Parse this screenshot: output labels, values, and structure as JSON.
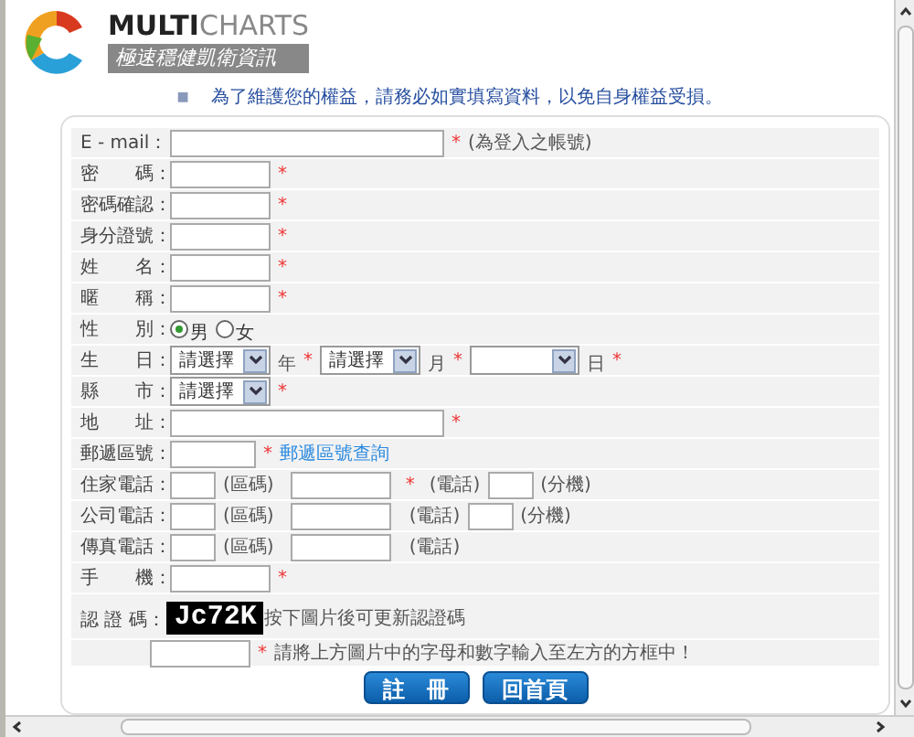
{
  "logo": {
    "brand_bold": "MULTI",
    "brand_light": "CHARTS",
    "tagline": "極速穩健凱衛資訊"
  },
  "notice": {
    "bullet": "■",
    "text": "為了維護您的權益，請務必如實填寫資料，以免自身權益受損。"
  },
  "form": {
    "rows": [
      {
        "kind": "email",
        "label": "E - mail：",
        "mark": "*",
        "note": "(為登入之帳號)"
      },
      {
        "kind": "text",
        "label": "密　　碼：",
        "mark": "*"
      },
      {
        "kind": "text",
        "label": "密碼確認：",
        "mark": "*"
      },
      {
        "kind": "text",
        "label": "身分證號：",
        "mark": "*"
      },
      {
        "kind": "text",
        "label": "姓　　名：",
        "mark": "*"
      },
      {
        "kind": "text",
        "label": "暱　　稱：",
        "mark": "*"
      },
      {
        "kind": "radio",
        "label": "性　　別：",
        "options": [
          {
            "label": "男",
            "selected": true
          },
          {
            "label": "女",
            "selected": false
          }
        ]
      },
      {
        "kind": "date",
        "label": "生　　日：",
        "selects": [
          {
            "value": "請選擇",
            "unit": "年",
            "mark": "*"
          },
          {
            "value": "請選擇",
            "unit": "月",
            "mark": "*"
          },
          {
            "unit": "日",
            "mark": "*"
          }
        ]
      },
      {
        "kind": "select",
        "label": "縣　　市：",
        "value": "請選擇",
        "mark": "*"
      },
      {
        "kind": "address",
        "label": "地　　址：",
        "mark": "*"
      },
      {
        "kind": "zip",
        "label": "郵遞區號：",
        "mark": "*",
        "link": "郵遞區號查詢"
      },
      {
        "kind": "phone",
        "label": "住家電話：",
        "area_label": "(區碼)",
        "number_mark": "*",
        "number_label": "(電話)",
        "ext_label": "(分機)"
      },
      {
        "kind": "phone",
        "label": "公司電話：",
        "area_label": "(區碼)",
        "number_label": "(電話)",
        "ext_label": "(分機)"
      },
      {
        "kind": "phone",
        "label": "傳真電話：",
        "area_label": "(區碼)",
        "number_label": "(電話)"
      },
      {
        "kind": "text",
        "label": "手　　機：",
        "mark": "*"
      }
    ],
    "captcha": {
      "label": "認 證 碼：",
      "code": "Jc72K",
      "hint": "按下圖片後可更新認證碼",
      "mark": "*",
      "instruction": "請將上方圖片中的字母和數字輸入至左方的方框中！"
    },
    "buttons": [
      "註　冊",
      "回首頁"
    ]
  }
}
